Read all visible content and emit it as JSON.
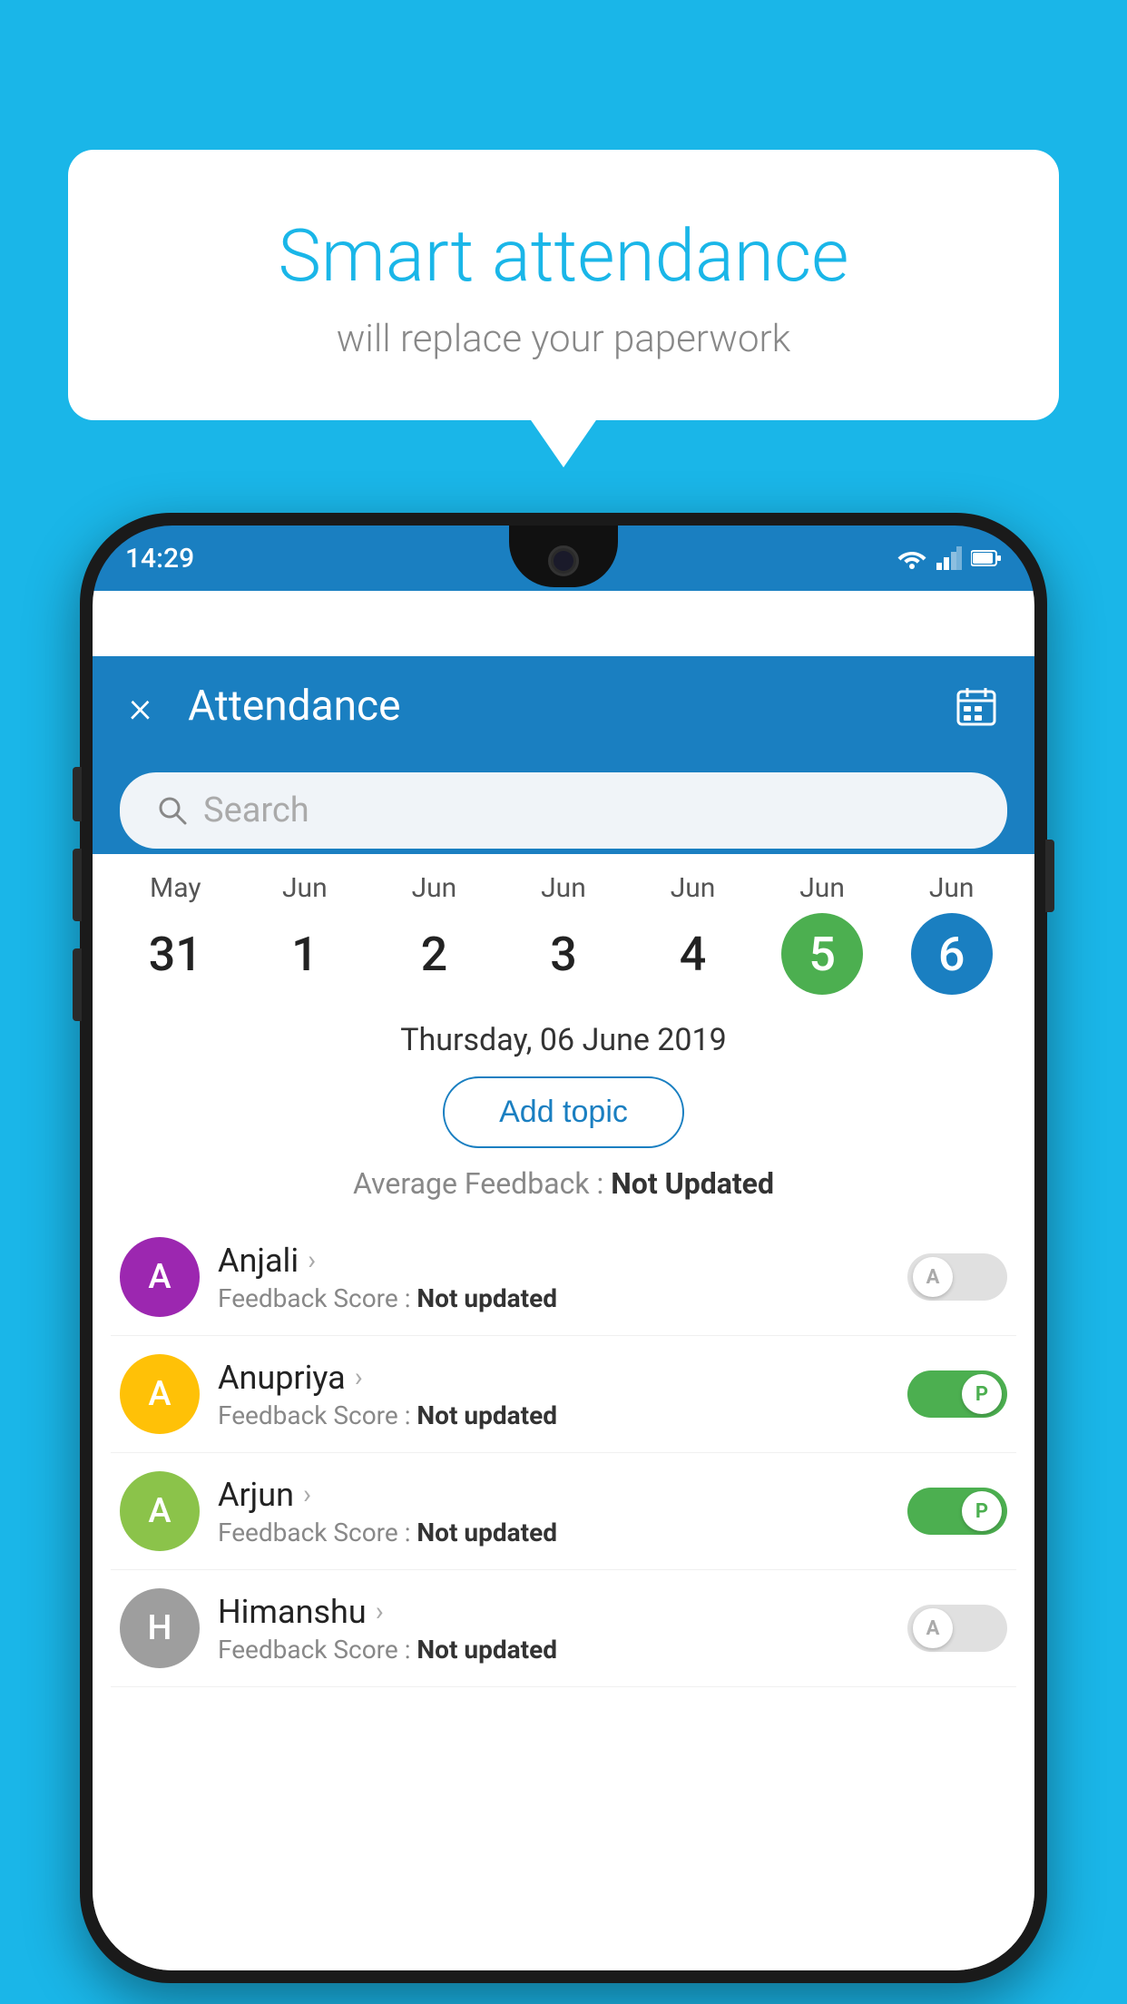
{
  "background_color": "#1ab6e8",
  "speech_bubble": {
    "title": "Smart attendance",
    "subtitle": "will replace your paperwork"
  },
  "status_bar": {
    "time": "14:29",
    "icons": [
      "wifi",
      "signal",
      "battery"
    ]
  },
  "app_header": {
    "title": "Attendance",
    "close_label": "×",
    "calendar_icon": "📅"
  },
  "search": {
    "placeholder": "Search"
  },
  "calendar": {
    "days": [
      {
        "month": "May",
        "date": "31",
        "style": "normal"
      },
      {
        "month": "Jun",
        "date": "1",
        "style": "normal"
      },
      {
        "month": "Jun",
        "date": "2",
        "style": "normal"
      },
      {
        "month": "Jun",
        "date": "3",
        "style": "normal"
      },
      {
        "month": "Jun",
        "date": "4",
        "style": "normal"
      },
      {
        "month": "Jun",
        "date": "5",
        "style": "today"
      },
      {
        "month": "Jun",
        "date": "6",
        "style": "selected"
      }
    ],
    "selected_date": "Thursday, 06 June 2019"
  },
  "add_topic_label": "Add topic",
  "avg_feedback_label": "Average Feedback :",
  "avg_feedback_value": "Not Updated",
  "students": [
    {
      "name": "Anjali",
      "avatar_letter": "A",
      "avatar_color": "#9c27b0",
      "feedback_label": "Feedback Score :",
      "feedback_value": "Not updated",
      "toggle": "off",
      "toggle_letter": "A"
    },
    {
      "name": "Anupriya",
      "avatar_letter": "A",
      "avatar_color": "#ffc107",
      "feedback_label": "Feedback Score :",
      "feedback_value": "Not updated",
      "toggle": "on",
      "toggle_letter": "P"
    },
    {
      "name": "Arjun",
      "avatar_letter": "A",
      "avatar_color": "#8bc34a",
      "feedback_label": "Feedback Score :",
      "feedback_value": "Not updated",
      "toggle": "on",
      "toggle_letter": "P"
    },
    {
      "name": "Himanshu",
      "avatar_letter": "H",
      "avatar_color": "#9e9e9e",
      "feedback_label": "Feedback Score :",
      "feedback_value": "Not updated",
      "toggle": "off",
      "toggle_letter": "A"
    }
  ]
}
